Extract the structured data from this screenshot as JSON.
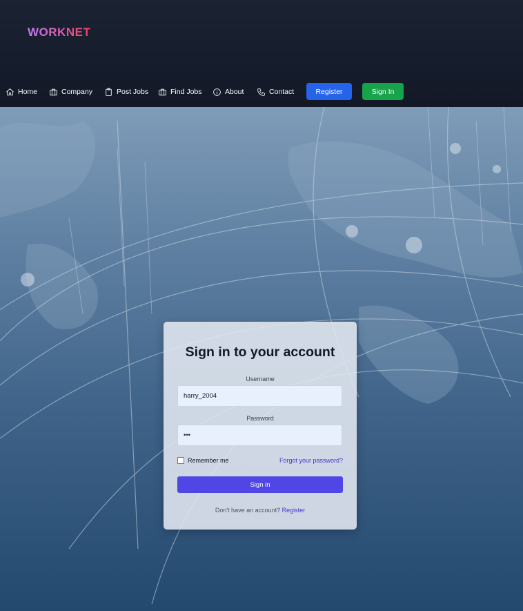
{
  "brand": {
    "logo_text": "WORKNET"
  },
  "nav": {
    "items": [
      {
        "label": "Home",
        "icon": "home-icon"
      },
      {
        "label": "Company",
        "icon": "briefcase-icon"
      },
      {
        "label": "Post Jobs",
        "icon": "clipboard-icon"
      },
      {
        "label": "Find Jobs",
        "icon": "briefcase-icon"
      },
      {
        "label": "About",
        "icon": "info-icon"
      },
      {
        "label": "Contact",
        "icon": "phone-icon"
      }
    ],
    "register_label": "Register",
    "signin_label": "Sign In"
  },
  "colors": {
    "register": "#2563eb",
    "signin": "#16a34a",
    "primary": "#4f46e5",
    "link": "#4338ca"
  },
  "login": {
    "title": "Sign in to your account",
    "username_label": "Username",
    "username_value": "harry_2004",
    "password_label": "Password",
    "password_value": "•••",
    "remember_label": "Remember me",
    "forgot_label": "Forgot your password?",
    "submit_label": "Sign in",
    "signup_prompt": "Don't have an account?",
    "signup_link": "Register"
  }
}
